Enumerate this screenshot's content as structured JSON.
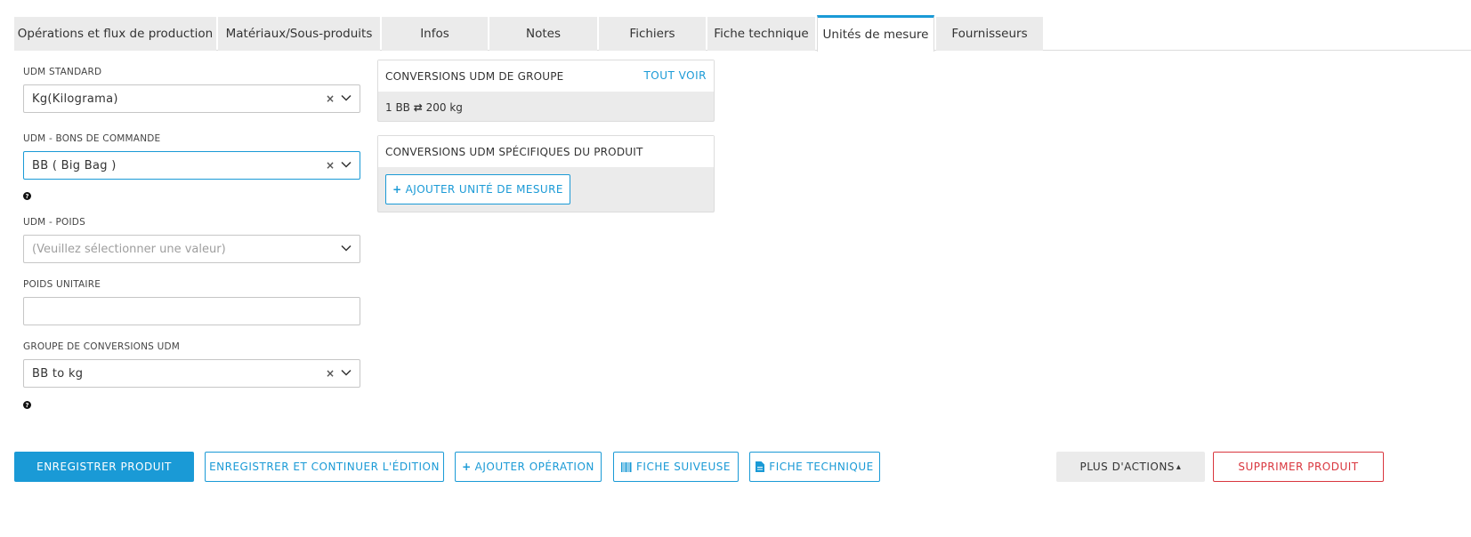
{
  "tabs": [
    {
      "label": "Opérations et flux de production",
      "active": false
    },
    {
      "label": "Matériaux/Sous-produits",
      "active": false
    },
    {
      "label": "Infos",
      "active": false
    },
    {
      "label": "Notes",
      "active": false
    },
    {
      "label": "Fichiers",
      "active": false
    },
    {
      "label": "Fiche technique",
      "active": false
    },
    {
      "label": "Unités de mesure",
      "active": true
    },
    {
      "label": "Fournisseurs",
      "active": false
    }
  ],
  "form": {
    "standard_uom": {
      "label": "UDM STANDARD",
      "value": "Kg(Kilograma)"
    },
    "po_uom": {
      "label": "UDM - BONS DE COMMANDE",
      "value": "BB ( Big Bag )"
    },
    "weight_uom": {
      "label": "UDM - POIDS",
      "placeholder": "(Veuillez sélectionner une valeur)"
    },
    "unit_weight": {
      "label": "POIDS UNITAIRE",
      "value": ""
    },
    "conversion_group": {
      "label": "GROUPE DE CONVERSIONS UDM",
      "value": "BB to kg"
    },
    "help_glyph": "?",
    "clear_glyph": "×"
  },
  "group_conversions": {
    "title": "CONVERSIONS UDM DE GROUPE",
    "view_all": "TOUT VOIR",
    "items": [
      {
        "left": "1 BB",
        "arrow": "⇄",
        "right": "200 kg"
      }
    ]
  },
  "product_conversions": {
    "title": "CONVERSIONS UDM SPÉCIFIQUES DU PRODUIT",
    "add_button": "AJOUTER UNITÉ DE MESURE",
    "add_icon": "+"
  },
  "actions": {
    "save": "ENREGISTRER PRODUIT",
    "save_continue": "ENREGISTRER ET CONTINUER L'ÉDITION",
    "add_operation": "AJOUTER OPÉRATION",
    "tracking_sheet": "FICHE SUIVEUSE",
    "tech_sheet": "FICHE TECHNIQUE",
    "more_actions": "PLUS D'ACTIONS",
    "delete": "SUPPRIMER PRODUIT",
    "plus_icon": "+",
    "caret_up": "▴"
  },
  "colors": {
    "accent": "#1a9ad6",
    "danger": "#d9363e",
    "tab_bg": "#ebebeb"
  }
}
